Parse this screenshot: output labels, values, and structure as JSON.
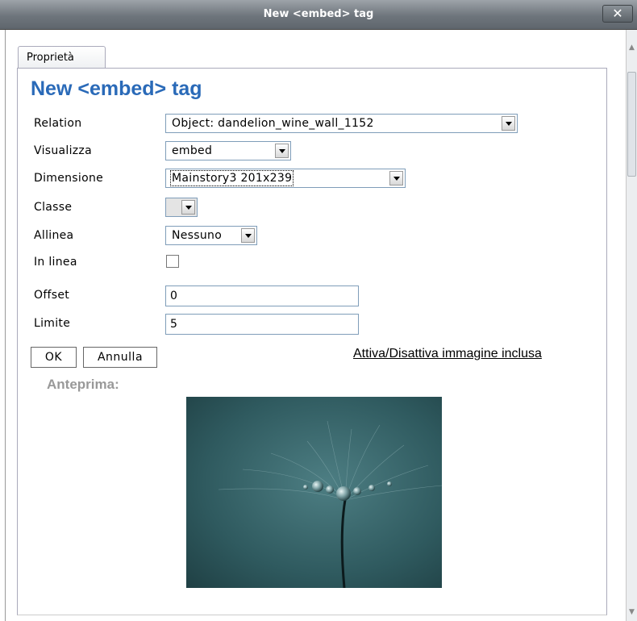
{
  "window": {
    "title": "New <embed> tag",
    "close_label": "✕"
  },
  "tabs": [
    {
      "label": "Proprietà"
    }
  ],
  "heading": "New <embed> tag",
  "form": {
    "relation": {
      "label": "Relation",
      "value": "Object: dandelion_wine_wall_1152"
    },
    "visualizza": {
      "label": "Visualizza",
      "value": "embed"
    },
    "dimensione": {
      "label": "Dimensione",
      "value": "Mainstory3 201x239"
    },
    "classe": {
      "label": "Classe",
      "value": ""
    },
    "allinea": {
      "label": "Allinea",
      "value": "Nessuno"
    },
    "in_linea": {
      "label": "In linea",
      "checked": false
    },
    "offset": {
      "label": "Offset",
      "value": "0"
    },
    "limite": {
      "label": "Limite",
      "value": "5"
    }
  },
  "buttons": {
    "ok": "OK",
    "annulla": "Annulla"
  },
  "toggle_link": "Attiva/Disattiva immagine inclusa",
  "preview": {
    "label": "Anteprima:",
    "image_bg": "#3f6b70"
  },
  "colors": {
    "heading": "#2a6ab8",
    "titlebar": "#6e757c"
  }
}
